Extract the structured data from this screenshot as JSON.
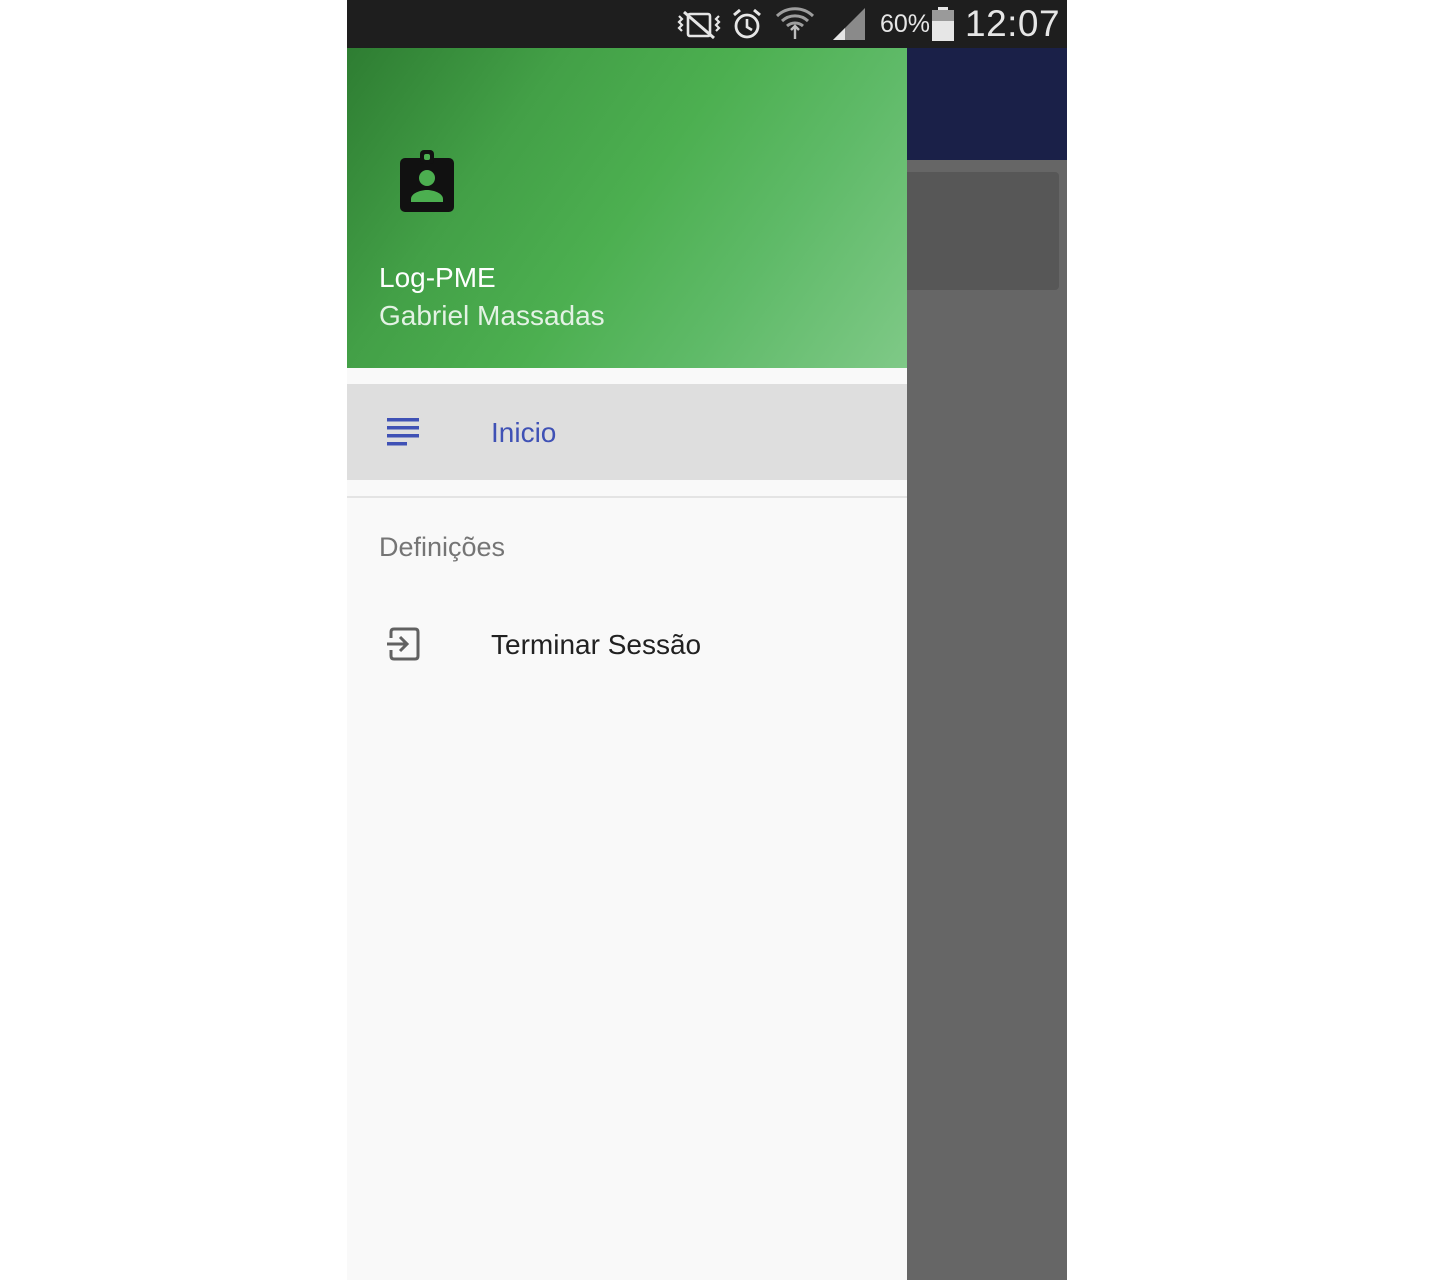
{
  "status_bar": {
    "icons": [
      "vibrate-mute-icon",
      "alarm-icon",
      "wifi-icon",
      "signal-icon",
      "battery-icon"
    ],
    "battery_percent": "60%",
    "time": "12:07"
  },
  "drawer": {
    "header": {
      "icon": "account-badge-icon",
      "title": "Log-PME",
      "subtitle": "Gabriel Massadas",
      "gradient_from": "#2e7d32",
      "gradient_to": "#81c784"
    },
    "items": [
      {
        "icon": "list-icon",
        "label": "Inicio",
        "selected": true,
        "color": "#3f51b5"
      }
    ],
    "sections": [
      {
        "title": "Definições",
        "items": [
          {
            "icon": "logout-icon",
            "label": "Terminar Sessão"
          }
        ]
      }
    ]
  },
  "background_app": {
    "appbar_color": "#1a237e",
    "scrim_color": "#666666"
  }
}
